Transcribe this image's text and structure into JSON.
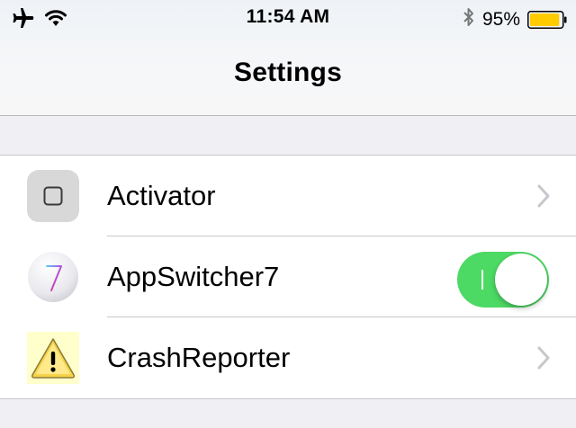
{
  "status_bar": {
    "time": "11:54 AM",
    "battery_percent": "95%",
    "battery_level": 0.95,
    "icons": [
      "airplane-icon",
      "wifi-icon",
      "bluetooth-icon",
      "battery-icon"
    ]
  },
  "nav": {
    "title": "Settings"
  },
  "rows": [
    {
      "label": "Activator",
      "icon": "activator-icon",
      "accessory": "chevron"
    },
    {
      "label": "AppSwitcher7",
      "icon": "appswitcher7-icon",
      "accessory": "toggle",
      "toggle_on": true
    },
    {
      "label": "CrashReporter",
      "icon": "crashreporter-icon",
      "accessory": "chevron"
    }
  ],
  "colors": {
    "toggle_on": "#4cd964",
    "battery_fill": "#ffcc00",
    "chevron": "#c7c7cc",
    "separator": "#c8c7cc",
    "grouped_background": "#efeff4"
  }
}
